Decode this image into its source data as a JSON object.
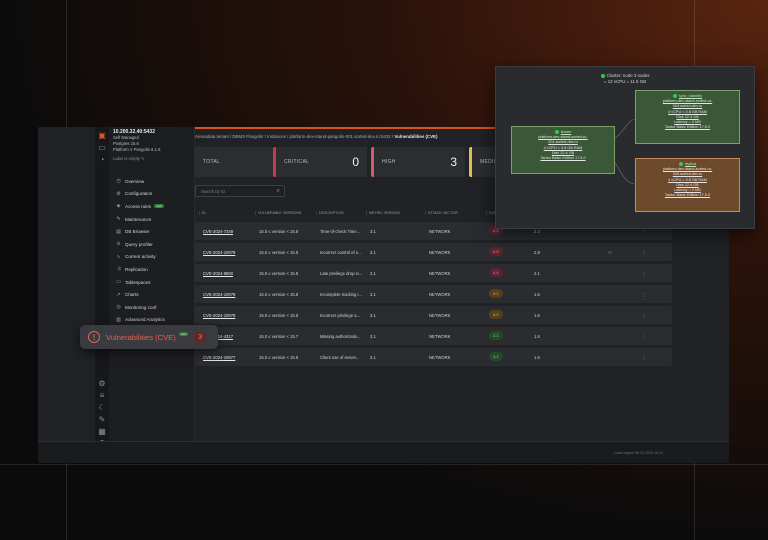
{
  "connection": {
    "host": "10.200.32.40:5432",
    "lines": [
      "Self Managed",
      "Postgres 15.6",
      "Platform V Pangolin 6.1.6"
    ],
    "label_action": "Label is empty"
  },
  "nav": [
    {
      "icon": "gauge",
      "label": "Overview"
    },
    {
      "icon": "gear",
      "label": "Configuration"
    },
    {
      "icon": "shield",
      "label": "Access rules",
      "badge": "new"
    },
    {
      "icon": "wrench",
      "label": "Maintenance"
    },
    {
      "icon": "db",
      "label": "DB Browser"
    },
    {
      "icon": "query",
      "label": "Query profiler"
    },
    {
      "icon": "activity",
      "label": "Current activity"
    },
    {
      "icon": "replication",
      "label": "Replication"
    },
    {
      "icon": "table",
      "label": "Tablespaces"
    },
    {
      "icon": "chart",
      "label": "Charts"
    },
    {
      "icon": "monitor",
      "label": "Monitoring conf"
    },
    {
      "icon": "analytics",
      "label": "Advanced Analytics"
    },
    {
      "icon": "bug",
      "label": "Vulnerabilities (CVE)"
    },
    {
      "icon": "calendar",
      "label": "Tasks"
    }
  ],
  "breadcrumbs": [
    "Arenadata tenant",
    "DBMS Pangolin",
    "Instances",
    "platform-dev-stand-pangolin-001.sorted-dev.ru:5432",
    "Vulnerabilities (CVE)"
  ],
  "summary": {
    "total_label": "TOTAL",
    "total": "7",
    "critical_label": "CRITICAL",
    "critical": "0",
    "high_label": "HIGH",
    "high": "3",
    "medium_label": "MEDIU"
  },
  "search": {
    "placeholder": "Search by ID"
  },
  "table": {
    "headers": [
      "ID",
      "VULNERABLE VERSIONS",
      "DESCRIPTION",
      "METRIC VERSION",
      "ATTACK VECTOR",
      "CVS"
    ],
    "rows": [
      {
        "id": "CVE-2024-7348",
        "versions": "15.0 ≤ version < 15.8",
        "desc": "Time-of-check Time...",
        "metric": "3.1",
        "vector": "NETWORK",
        "score": "8.8",
        "sev": "red",
        "epss": "2.4"
      },
      {
        "id": "CVE-2024-10979",
        "versions": "15.0 ≤ version < 15.8",
        "desc": "Incorrect control of e...",
        "metric": "3.1",
        "vector": "NETWORK",
        "score": "8.8",
        "sev": "red",
        "epss": "2.8"
      },
      {
        "id": "CVE-2024-9860",
        "versions": "15.0 ≤ version < 15.8",
        "desc": "Late privilege drop in...",
        "metric": "3.1",
        "vector": "NETWORK",
        "score": "8.8",
        "sev": "red",
        "epss": "2.1"
      },
      {
        "id": "CVE-2024-10978",
        "versions": "15.0 ≤ version < 15.8",
        "desc": "Incomplete tracking i...",
        "metric": "3.1",
        "vector": "NETWORK",
        "score": "4.2",
        "sev": "amber",
        "epss": "1.6"
      },
      {
        "id": "CVE-2024-10978",
        "versions": "15.0 ≤ version < 15.8",
        "desc": "Incorrect privilege a...",
        "metric": "3.1",
        "vector": "NETWORK",
        "score": "4.2",
        "sev": "amber",
        "epss": "1.6"
      },
      {
        "id": "CVE-2024-4317",
        "versions": "15.0 ≤ version < 15.7",
        "desc": "Missing authorizatio...",
        "metric": "3.1",
        "vector": "NETWORK",
        "score": "3.1",
        "sev": "green",
        "epss": "1.6"
      },
      {
        "id": "CVE-2024-10977",
        "versions": "15.0 ≤ version < 15.8",
        "desc": "Client use of server...",
        "metric": "3.1",
        "vector": "NETWORK",
        "score": "3.1",
        "sev": "green",
        "epss": "1.6"
      }
    ]
  },
  "status_copyright": "Load engine 06.12.2025 10:12",
  "badge": {
    "label": "Vulnerabilities (CVE)",
    "tag": "new",
    "count": "3"
  },
  "cluster": {
    "title": "Cluster: node 3 nodes",
    "subtitle": "= 12 vCPU = 11.5 GB",
    "leader": {
      "role": "leader",
      "lines": [
        "platform-dev-stand-sorted-ru-",
        "001.sorted-dev.ru",
        "4 vCPU = 3.8 GB RAM",
        "Disk 22.4 GB",
        "Tantor Basic Edition 17.5.0"
      ]
    },
    "standby": {
      "role": "sync_standby",
      "lines": [
        "platform-dev-stand-sorted-ru-",
        "004.sorted-dev.ru",
        "4 vCPU = 3.8 GB RAM",
        "Disk 22.4 GB",
        "Latency = 0 MB",
        "Tantor Basic Edition 17.5.0"
      ]
    },
    "replica": {
      "role": "replica",
      "lines": [
        "platform-dev-stand-sorted-ru-",
        "005.sorted-dev.ru",
        "4 vCPU = 3.8 GB RAM",
        "Disk 22.4 GB",
        "Latency = 0 MB",
        "Tantor Basic Edition 17.5.0"
      ]
    }
  }
}
